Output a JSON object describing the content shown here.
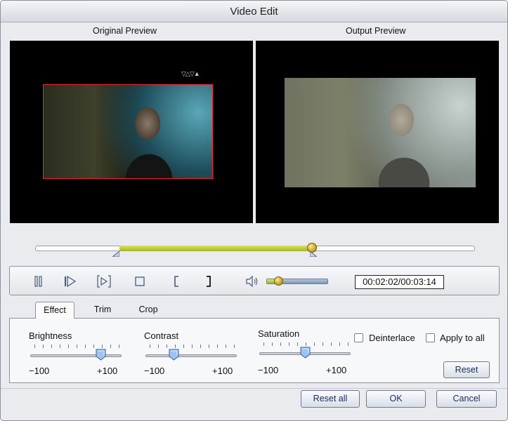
{
  "window": {
    "title": "Video Edit"
  },
  "preview": {
    "original_label": "Original Preview",
    "output_label": "Output Preview",
    "watermark": "▽△▽▲"
  },
  "timeline": {
    "selection_start_fraction": 0.19,
    "selection_end_fraction": 0.63,
    "playhead_fraction": 0.63
  },
  "playback": {
    "pause_icon": "pause-icon",
    "next_frame_icon": "next-frame-icon",
    "play_segment_icon": "play-segment-icon",
    "stop_icon": "stop-icon",
    "mark_in_icon": "mark-in-icon",
    "mark_out_icon": "mark-out-icon",
    "volume_icon": "speaker-icon",
    "volume_level": 0.15,
    "time_display": "00:02:02/00:03:14"
  },
  "tabs": [
    {
      "label": "Effect",
      "active": true
    },
    {
      "label": "Trim",
      "active": false
    },
    {
      "label": "Crop",
      "active": false
    }
  ],
  "effect": {
    "brightness": {
      "label": "Brightness",
      "min_label": "−100",
      "max_label": "+100",
      "value": 0.77
    },
    "contrast": {
      "label": "Contrast",
      "min_label": "−100",
      "max_label": "+100",
      "value": 0.31
    },
    "saturation": {
      "label": "Saturation",
      "min_label": "−100",
      "max_label": "+100",
      "value": 0.5
    },
    "deinterlace": {
      "label": "Deinterlace",
      "checked": false
    },
    "apply_to_all": {
      "label": "Apply to all",
      "checked": false
    },
    "reset_label": "Reset"
  },
  "footer": {
    "reset_all_label": "Reset all",
    "ok_label": "OK",
    "cancel_label": "Cancel"
  },
  "colors": {
    "accent": "#a8b32b",
    "selection_border": "#ff2020",
    "button_text": "#1a2d5a"
  }
}
